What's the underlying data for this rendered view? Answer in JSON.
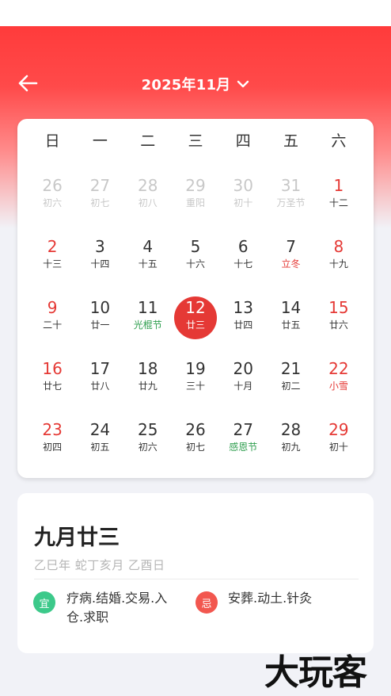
{
  "header": {
    "month_label": "2025年11月",
    "back_icon": "arrow-left-icon",
    "dropdown_icon": "chevron-down-icon",
    "accent_color": "#ff3b3b"
  },
  "calendar": {
    "weekdays": [
      "日",
      "一",
      "二",
      "三",
      "四",
      "五",
      "六"
    ],
    "selected_color": "#e53935",
    "days": [
      {
        "d": "26",
        "sub": "初六",
        "outside": true
      },
      {
        "d": "27",
        "sub": "初七",
        "outside": true
      },
      {
        "d": "28",
        "sub": "初八",
        "outside": true
      },
      {
        "d": "29",
        "sub": "重阳",
        "outside": true
      },
      {
        "d": "30",
        "sub": "初十",
        "outside": true
      },
      {
        "d": "31",
        "sub": "万圣节",
        "outside": true
      },
      {
        "d": "1",
        "sub": "十二"
      },
      {
        "d": "2",
        "sub": "十三"
      },
      {
        "d": "3",
        "sub": "十四"
      },
      {
        "d": "4",
        "sub": "十五"
      },
      {
        "d": "5",
        "sub": "十六"
      },
      {
        "d": "6",
        "sub": "十七"
      },
      {
        "d": "7",
        "sub": "立冬",
        "subType": "term"
      },
      {
        "d": "8",
        "sub": "十九"
      },
      {
        "d": "9",
        "sub": "二十"
      },
      {
        "d": "10",
        "sub": "廿一"
      },
      {
        "d": "11",
        "sub": "光棍节",
        "subType": "festival"
      },
      {
        "d": "12",
        "sub": "廿三",
        "selected": true
      },
      {
        "d": "13",
        "sub": "廿四"
      },
      {
        "d": "14",
        "sub": "廿五"
      },
      {
        "d": "15",
        "sub": "廿六"
      },
      {
        "d": "16",
        "sub": "廿七"
      },
      {
        "d": "17",
        "sub": "廿八"
      },
      {
        "d": "18",
        "sub": "廿九"
      },
      {
        "d": "19",
        "sub": "三十"
      },
      {
        "d": "20",
        "sub": "十月"
      },
      {
        "d": "21",
        "sub": "初二"
      },
      {
        "d": "22",
        "sub": "小雪",
        "subType": "term"
      },
      {
        "d": "23",
        "sub": "初四"
      },
      {
        "d": "24",
        "sub": "初五"
      },
      {
        "d": "25",
        "sub": "初六"
      },
      {
        "d": "26",
        "sub": "初七"
      },
      {
        "d": "27",
        "sub": "感恩节",
        "subType": "festival"
      },
      {
        "d": "28",
        "sub": "初九"
      },
      {
        "d": "29",
        "sub": "初十"
      }
    ]
  },
  "detail": {
    "lunar_date": "九月廿三",
    "ganzhi": "乙巳年 蛇丁亥月 乙酉日",
    "yi_label": "宜",
    "yi_text": "疗病.结婚.交易.入仓.求职",
    "ji_label": "忌",
    "ji_text": "安葬.动土.针灸",
    "yi_color": "#3cc98a",
    "ji_color": "#f2574f"
  },
  "watermark": "大玩客"
}
